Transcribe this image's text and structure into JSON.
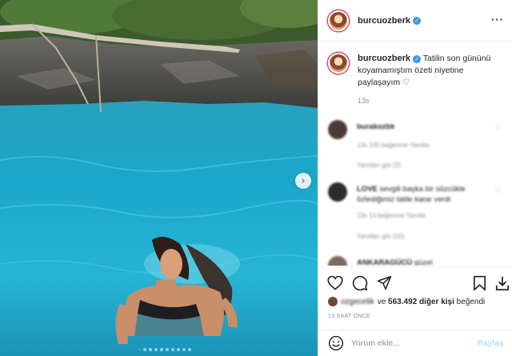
{
  "header": {
    "username": "burcuozberk",
    "verified_mark": "✓",
    "more_label": "···"
  },
  "caption": {
    "username": "burcuozberk",
    "text": "Tatilin son gününü koyamamıştım özeti niyetine paylaşayım",
    "heart": "♡",
    "time": "13s"
  },
  "comments": [
    {
      "username": "burakozbk",
      "text": "",
      "meta": "13s   100 beğenme   Yanıtla",
      "replies": "Yanıtları gör (2)"
    },
    {
      "username": "LOVE",
      "text": "sevgili başka bir sözcükle özlediğimiz tatile karar verdi",
      "meta": "13s   14 beğenme   Yanıtla",
      "replies": "Yanıtları gör (10)"
    },
    {
      "username": "ANKARAGÜCÜ",
      "text": "güzel görünüyorsun",
      "meta": "",
      "replies": ""
    }
  ],
  "actions": {
    "like_icon": "heart-outline-icon",
    "comment_icon": "comment-bubble-icon",
    "share_icon": "send-plane-icon",
    "save_icon": "bookmark-icon",
    "download_icon": "download-icon"
  },
  "likes": {
    "liker": "ozgecelik",
    "connector": "ve",
    "count": "563.492 diğer kişi",
    "suffix": "beğendi"
  },
  "post_time": "13 SAAT ÖNCE",
  "comment_input": {
    "placeholder": "Yorum ekle...",
    "value": "",
    "post_label": "Paylaş",
    "emoji_icon": "smiley-icon"
  },
  "carousel": {
    "next_label": "›",
    "slide_count": 10,
    "active_index": 0
  },
  "colors": {
    "verified": "#3897f0",
    "carousel_active": "#3a99f2",
    "post_button_disabled": "#b2dffc",
    "water": "#1fa8c8"
  }
}
